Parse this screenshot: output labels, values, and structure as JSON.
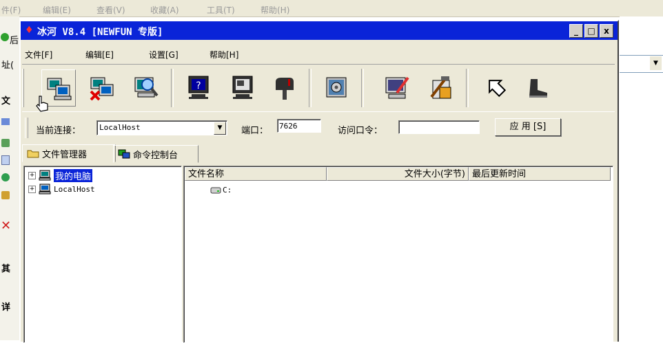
{
  "background_window": {
    "menu": [
      "件(F)",
      "编辑(E)",
      "查看(V)",
      "收藏(A)",
      "工具(T)",
      "帮助(H)"
    ],
    "left_fragments": [
      "后",
      "址(",
      "文",
      "其",
      "详"
    ]
  },
  "window": {
    "title": "冰河 V8.4 [NEWFUN 专版]",
    "controls": {
      "minimize": "_",
      "maximize": "□",
      "close": "x"
    }
  },
  "menu": {
    "file": "文件[F]",
    "edit": "编辑[E]",
    "settings": "设置[G]",
    "help": "帮助[H]"
  },
  "toolbar": {
    "icons": [
      "add-host-icon",
      "delete-host-icon",
      "search-host-icon",
      "capture-screen-icon",
      "control-screen-icon",
      "mailbox-icon",
      "system-settings-icon",
      "edit-file-icon",
      "configure-server-icon",
      "back-arrow-icon",
      "exit-boot-icon"
    ]
  },
  "connection": {
    "current_label": "当前连接：",
    "current_value": "LocalHost",
    "port_label": "端口：",
    "port_value": "7626",
    "password_label": "访问口令：",
    "password_value": "",
    "apply_label": "应 用 [S]"
  },
  "tabs": {
    "file_manager": "文件管理器",
    "command_console": "命令控制台"
  },
  "tree": {
    "nodes": [
      {
        "label": "我的电脑",
        "selected": true
      },
      {
        "label": "LocalHost",
        "selected": false
      }
    ]
  },
  "file_list": {
    "columns": [
      "文件名称",
      "文件大小(字节)",
      "最后更新时间"
    ],
    "rows": [
      {
        "name": "C:"
      }
    ]
  },
  "colors": {
    "title_bar": "#0a24d8",
    "selection": "#0a24d8",
    "face": "#ece9d8"
  }
}
